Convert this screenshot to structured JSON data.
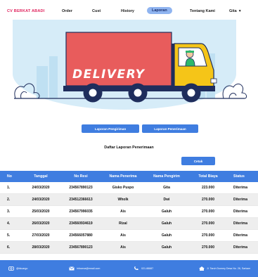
{
  "nav": {
    "brand": "CV BERKAT ABADI",
    "items": [
      "Order",
      "Cust",
      "History",
      "Laporan",
      "Tentang Kami"
    ],
    "active": "Laporan",
    "user_label": "Gita"
  },
  "hero": {
    "truck_text": "DELIVERY",
    "colors": {
      "truck": "#e85c5c",
      "cab": "#f5c518",
      "sky": "#d6ecf8"
    }
  },
  "reports": {
    "btn_pengiriman": "Laporan Pengiriman",
    "btn_penerimaan": "Laporan Penerimaan",
    "title": "Daftar Laporan Penerimaan",
    "print_label": "Cetak"
  },
  "table": {
    "headers": [
      "No",
      "Tanggal",
      "No Resi",
      "Nama Penerima",
      "Nama Pengirim",
      "Total Biaya",
      "Status"
    ],
    "rows": [
      [
        "1.",
        "24/03/2020",
        "234567890123",
        "Gisko Puspo",
        "Gita",
        "223.000",
        "Diterima"
      ],
      [
        "2.",
        "24/03/2020",
        "234512366613",
        "Wholk",
        "Dwi",
        "270.000",
        "Diterima"
      ],
      [
        "3.",
        "25/03/2020",
        "234567996035",
        "Ais",
        "Galuh",
        "270.000",
        "Diterima"
      ],
      [
        "4.",
        "26/03/2020",
        "234560934619",
        "Rizal",
        "Galuh",
        "270.000",
        "Diterima"
      ],
      [
        "5.",
        "27/03/2020",
        "234566057880",
        "Ais",
        "Galuh",
        "270.000",
        "Diterima"
      ],
      [
        "6.",
        "28/03/2020",
        "234567890123",
        "Ais",
        "Galuh",
        "270.000",
        "Diterima"
      ]
    ]
  },
  "footer": {
    "instagram": "@bkcargo",
    "email": "infoseva@email.com",
    "phone": "021-88887",
    "address": "Jl. Taruh Dummy Desa No. 26, Sarkam"
  },
  "colors": {
    "primary": "#3f7de0",
    "brand": "#e0245e"
  }
}
